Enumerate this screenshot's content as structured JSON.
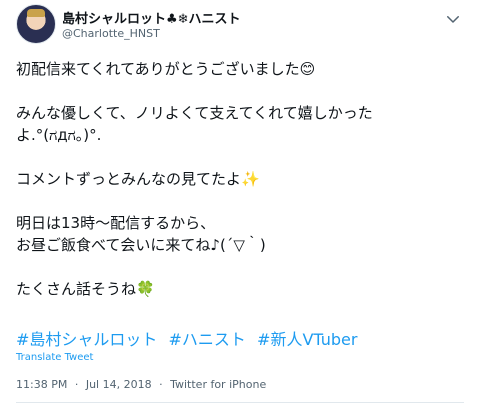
{
  "user": {
    "display_name": "島村シャルロット♣❄ハニスト",
    "handle": "@Charlotte_HNST"
  },
  "tweet": {
    "line1": "初配信来てくれてありがとうございました😊",
    "line2a": "みんな優しくて、ノリよくて支えてくれて嬉しかった",
    "line2b": "よ.°(ಗдಗ。)°.",
    "line3": "コメントずっとみんなの見てたよ✨",
    "line4a": "明日は13時〜配信するから、",
    "line4b": "お昼ご飯食べて会いに来てね♪(´▽｀)",
    "line5": "たくさん話そうね🍀",
    "hashtags": [
      "#島村シャルロット",
      "#ハニスト",
      "#新人VTuber"
    ],
    "translate_label": "Translate Tweet",
    "time": "11:38 PM",
    "sep1": "·",
    "date": "Jul 14, 2018",
    "sep2": "·",
    "source": "Twitter for iPhone"
  },
  "icons": {
    "avatar": "avatar-image",
    "more": "chevron-down-icon"
  },
  "colors": {
    "link": "#1d9bf0",
    "muted": "#536471",
    "text": "#0f1419"
  }
}
